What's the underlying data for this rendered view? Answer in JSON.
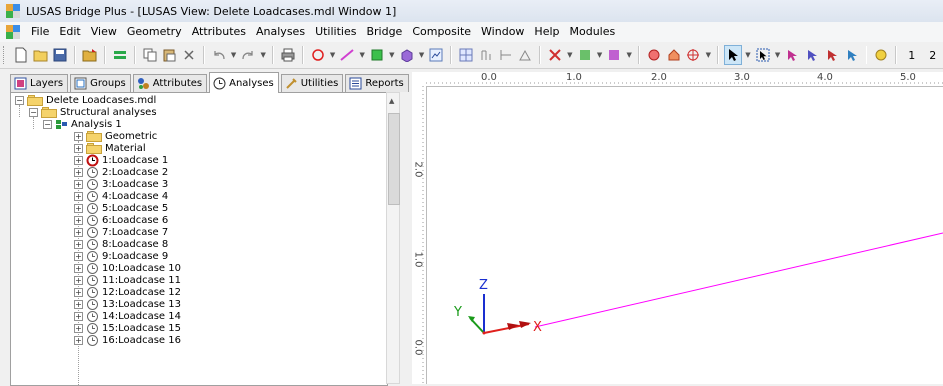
{
  "window": {
    "title": "LUSAS Bridge Plus - [LUSAS View: Delete Loadcases.mdl Window 1]"
  },
  "menu": [
    "File",
    "Edit",
    "View",
    "Geometry",
    "Attributes",
    "Analyses",
    "Utilities",
    "Bridge",
    "Composite",
    "Window",
    "Help",
    "Modules"
  ],
  "toolbar": {
    "buttons": [
      "new-icon",
      "open-icon",
      "save-icon",
      "open-folder-icon",
      "grid-icon",
      "copy-icon",
      "paste-icon",
      "delete-icon",
      "undo-icon",
      "redo-icon",
      "print-icon",
      "point-icon",
      "line-icon",
      "surface-icon",
      "volume-icon",
      "view-icon",
      "mesh-icon",
      "dimension-icon",
      "attribute-icon",
      "support-icon",
      "load-icon",
      "rotate-icon",
      "pan-icon",
      "select-icon",
      "select-box-icon",
      "cursor-icon",
      "cursor-plus-icon",
      "cursor-minus-icon",
      "wizard-icon"
    ],
    "trailing_text": [
      "1",
      "2"
    ]
  },
  "panel": {
    "tabs": [
      {
        "label": "Layers",
        "icon": "layers-icon",
        "active": false
      },
      {
        "label": "Groups",
        "icon": "groups-icon",
        "active": false
      },
      {
        "label": "Attributes",
        "icon": "attributes-icon",
        "active": false
      },
      {
        "label": "Analyses",
        "icon": "analyses-icon",
        "active": true
      },
      {
        "label": "Utilities",
        "icon": "utilities-icon",
        "active": false
      },
      {
        "label": "Reports",
        "icon": "reports-icon",
        "active": false
      }
    ],
    "tree": {
      "root": "Delete Loadcases.mdl",
      "structural": "Structural analyses",
      "analysis": "Analysis 1",
      "geometric": "Geometric",
      "material": "Material",
      "loadcases": [
        "1:Loadcase 1",
        "2:Loadcase 2",
        "3:Loadcase 3",
        "4:Loadcase 4",
        "5:Loadcase 5",
        "6:Loadcase 6",
        "7:Loadcase 7",
        "8:Loadcase 8",
        "9:Loadcase 9",
        "10:Loadcase 10",
        "11:Loadcase 11",
        "12:Loadcase 12",
        "13:Loadcase 13",
        "14:Loadcase 14",
        "15:Loadcase 15",
        "16:Loadcase 16"
      ],
      "active_loadcase": "1:Loadcase 1"
    }
  },
  "viewport": {
    "ruler_top_labels": [
      "0.0",
      "1.0",
      "2.0",
      "3.0",
      "4.0",
      "5.0"
    ],
    "ruler_left_labels": [
      "2.0",
      "1.0",
      "0.0"
    ],
    "axes": {
      "x": "X",
      "y": "Y",
      "z": "Z"
    },
    "colors": {
      "x_axis": "#e0201c",
      "y_axis": "#1a9a1a",
      "z_axis": "#1a2fd0",
      "member_line": "#ff00ff"
    }
  }
}
